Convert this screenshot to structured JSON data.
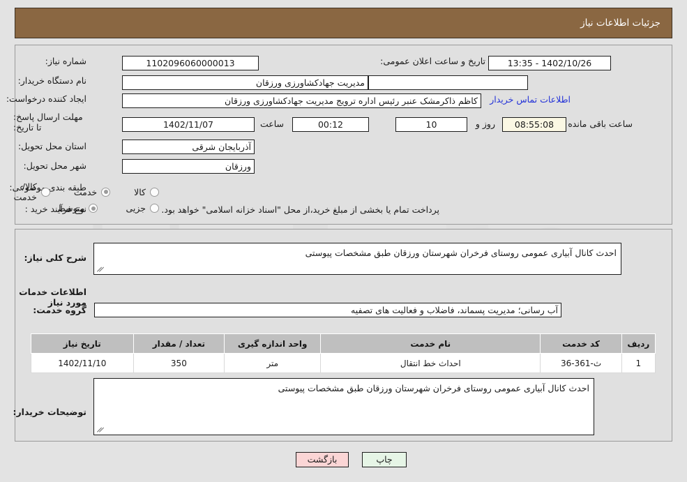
{
  "header": {
    "title": "جزئیات اطلاعات نیاز"
  },
  "form": {
    "need_number_label": "شماره نیاز:",
    "need_number_value": "1102096060000013",
    "announce_datetime_label": "تاریخ و ساعت اعلان عمومی:",
    "announce_datetime_value": "1402/10/26 - 13:35",
    "buyer_org_label": "نام دستگاه خریدار:",
    "buyer_org_value": "مدیریت جهادکشاورزی ورزقان",
    "buyer_org_value2": "",
    "requester_label": "ایجاد کننده درخواست:",
    "requester_value": "کاظم ذاکرمشک عنبر رئیس اداره ترویج مدیریت جهادکشاورزی ورزقان",
    "requester_value2": "اداره ترویج مدیریت جهادکشاورزی ورزقان",
    "contact_link": "اطلاعات تماس خریدار",
    "deadline_label": "مهلت ارسال پاسخ: تا تاریخ:",
    "deadline_date": "1402/11/07",
    "deadline_hour_label": "ساعت",
    "deadline_hour": "00:12",
    "remaining_days": "10",
    "remaining_days_label": "روز و",
    "remaining_time": "08:55:08",
    "remaining_time_label": "ساعت باقی مانده",
    "province_label": "استان محل تحویل:",
    "province_value": "آذربایجان شرقی",
    "city_label": "شهر محل تحویل:",
    "city_value": "ورزقان",
    "category_label": "طبقه بندی موضوعی:",
    "category_options": [
      {
        "label": "کالا",
        "selected": false
      },
      {
        "label": "خدمت",
        "selected": true
      },
      {
        "label": "کالا/خدمت",
        "selected": false
      }
    ],
    "process_label": "نوع فرآیند خرید :",
    "process_options": [
      {
        "label": "جزیی",
        "selected": false
      },
      {
        "label": "متوسط",
        "selected": true
      }
    ],
    "treasury_note": "پرداخت تمام یا بخشی از مبلغ خرید،از محل \"اسناد خزانه اسلامی\" خواهد بود."
  },
  "description": {
    "label": "شرح کلی نیاز:",
    "value": "احدث کانال آبیاری عمومی روستای فرخران شهرستان ورزقان طبق مشخصات پیوستی"
  },
  "services_section": {
    "heading": "اطلاعات خدمات مورد نیاز",
    "group_label": "گروه خدمت:",
    "group_value": "آب رسانی؛ مدیریت پسماند، فاضلاب و فعالیت های تصفیه"
  },
  "table": {
    "columns": [
      "ردیف",
      "کد خدمت",
      "نام خدمت",
      "واحد اندازه گیری",
      "تعداد / مقدار",
      "تاریخ نیاز"
    ],
    "rows": [
      {
        "radif": "1",
        "code": "ث-361-36",
        "name": "احداث خط انتقال",
        "unit": "متر",
        "qty": "350",
        "date": "1402/11/10"
      }
    ]
  },
  "buyer_notes": {
    "label": "توضیحات خریدار:",
    "value": "احدث کانال آبیاری عمومی روستای فرخران شهرستان ورزقان طبق مشخصات پیوستی"
  },
  "footer": {
    "print_label": "چاپ",
    "back_label": "بازگشت"
  },
  "watermark": {
    "text": "AriaTender.net"
  },
  "colors": {
    "header_bg": "#8a6742",
    "panel_bg": "#e0e0e0",
    "page_bg": "#e3e3e3",
    "table_header_bg": "#bfbfbf",
    "link": "#2332d8",
    "print_btn": "#e6f5e6",
    "back_btn": "#fbd5d5",
    "cream_field": "#fbf8e4"
  }
}
